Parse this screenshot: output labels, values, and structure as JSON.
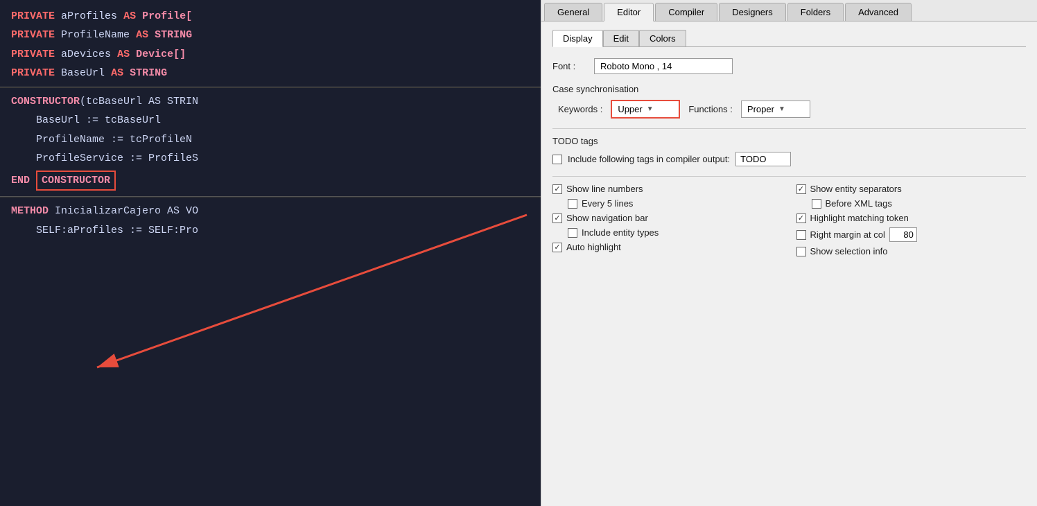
{
  "tabs": {
    "items": [
      "General",
      "Editor",
      "Compiler",
      "Designers",
      "Folders",
      "Advanced"
    ],
    "active": "Editor"
  },
  "sub_tabs": {
    "items": [
      "Display",
      "Edit",
      "Colors"
    ],
    "active": "Display"
  },
  "font": {
    "label": "Font :",
    "value": "Roboto Mono , 14"
  },
  "case_sync": {
    "label": "Case synchronisation",
    "keywords_label": "Keywords :",
    "keywords_value": "Upper",
    "functions_label": "Functions :",
    "functions_value": "Proper"
  },
  "todo": {
    "label": "TODO tags",
    "checkbox_label": "Include following tags in compiler output:",
    "input_value": "TODO"
  },
  "options": [
    {
      "checked": true,
      "label": "Show line numbers"
    },
    {
      "checked": false,
      "label": "Every 5 lines"
    },
    {
      "checked": true,
      "label": "Show navigation bar"
    },
    {
      "checked": false,
      "label": "Include entity types"
    },
    {
      "checked": true,
      "label": "Auto highlight"
    },
    {
      "checked": true,
      "label": "Show entity separators"
    },
    {
      "checked": false,
      "label": "Before XML tags"
    },
    {
      "checked": true,
      "label": "Highlight matching token"
    },
    {
      "checked": false,
      "label": "Right margin at col"
    },
    {
      "checked": false,
      "label": "Show selection info"
    }
  ],
  "margin_col": "80",
  "code": {
    "lines": [
      {
        "type": "var_decl",
        "text": "PRIVATE aProfiles AS Profile["
      },
      {
        "type": "var_decl",
        "text": "PRIVATE ProfileName AS STRING"
      },
      {
        "type": "var_decl",
        "text": "PRIVATE aDevices AS Device[]"
      },
      {
        "type": "var_decl",
        "text": "PRIVATE BaseUrl AS STRING"
      },
      {
        "type": "divider"
      },
      {
        "type": "constructor_header",
        "text": "CONSTRUCTOR(tcBaseUrl AS STRIN"
      },
      {
        "type": "assign",
        "text": "BaseUrl := tcBaseUrl"
      },
      {
        "type": "assign",
        "text": "ProfileName := tcProfileN"
      },
      {
        "type": "assign",
        "text": "ProfileService := ProfileS"
      },
      {
        "type": "end_constructor",
        "text": "END CONSTRUCTOR"
      },
      {
        "type": "divider"
      },
      {
        "type": "method_header",
        "text": "METHOD InicializarCajero AS VO"
      },
      {
        "type": "method_sub",
        "text": "SELF:aProfiles := SELF:Pro"
      }
    ]
  }
}
